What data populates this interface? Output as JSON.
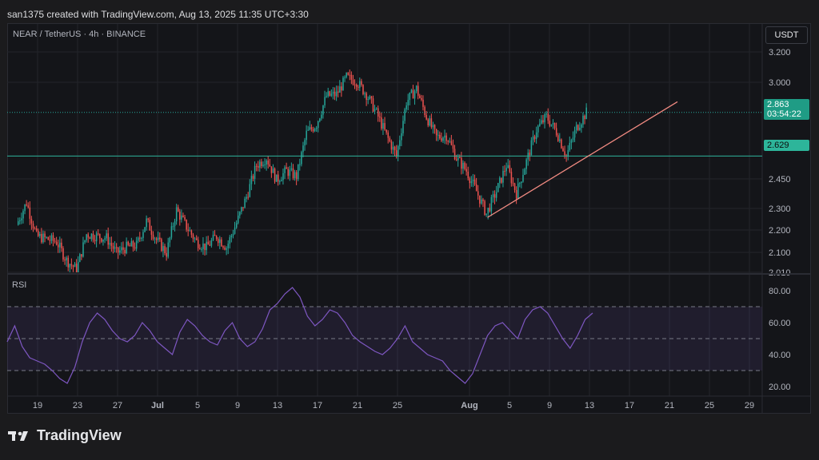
{
  "header": {
    "text": "san1375 created with TradingView.com, Aug 13, 2025 11:35 UTC+3:30"
  },
  "symbol": {
    "text": "NEAR / TetherUS · 4h · BINANCE"
  },
  "price_axis": {
    "currency": "USDT",
    "ticks": [
      "3.200",
      "3.000",
      "2.450",
      "2.300",
      "2.200",
      "2.100",
      "2.010"
    ]
  },
  "current_price": {
    "value": "2.863",
    "countdown": "03:54:22"
  },
  "level_price": {
    "value": "2.629"
  },
  "rsi": {
    "label": "RSI",
    "ticks": [
      "80.00",
      "60.00",
      "40.00",
      "20.00"
    ]
  },
  "time_axis": {
    "ticks": [
      "19",
      "23",
      "27",
      "Jul",
      "5",
      "9",
      "13",
      "17",
      "21",
      "25",
      "Aug",
      "5",
      "9",
      "13",
      "17",
      "21",
      "25",
      "29"
    ]
  },
  "brand": {
    "name": "TradingView"
  },
  "colors": {
    "up": "#26a69a",
    "down": "#ef5350",
    "rsi_line": "#7e57c2",
    "trendline": "#f28b82",
    "level": "#2db59a"
  },
  "chart_data": {
    "type": "candlestick",
    "title": "NEAR / TetherUS · 4h · BINANCE",
    "ylim": [
      2.01,
      3.26
    ],
    "x_labels": [
      "19",
      "23",
      "27",
      "Jul",
      "5",
      "9",
      "13",
      "17",
      "21",
      "25",
      "Aug",
      "5",
      "9",
      "13",
      "17",
      "21",
      "25",
      "29"
    ],
    "price_path": [
      [
        "Jun 17",
        2.26
      ],
      [
        "Jun 18",
        2.38
      ],
      [
        "Jun 19",
        2.2
      ],
      [
        "Jun 21",
        2.17
      ],
      [
        "Jun 22",
        2.07
      ],
      [
        "Jun 23",
        2.02
      ],
      [
        "Jun 24",
        2.21
      ],
      [
        "Jun 26",
        2.19
      ],
      [
        "Jun 27",
        2.11
      ],
      [
        "Jun 28",
        2.14
      ],
      [
        "Jun 29",
        2.15
      ],
      [
        "Jun 30",
        2.28
      ],
      [
        "Jul 1",
        2.18
      ],
      [
        "Jul 2",
        2.11
      ],
      [
        "Jul 3",
        2.34
      ],
      [
        "Jul 4",
        2.25
      ],
      [
        "Jul 5",
        2.17
      ],
      [
        "Jul 6",
        2.14
      ],
      [
        "Jul 7",
        2.2
      ],
      [
        "Jul 8",
        2.14
      ],
      [
        "Jul 9",
        2.27
      ],
      [
        "Jul 10",
        2.41
      ],
      [
        "Jul 11",
        2.58
      ],
      [
        "Jul 12",
        2.62
      ],
      [
        "Jul 13",
        2.5
      ],
      [
        "Jul 14",
        2.55
      ],
      [
        "Jul 15",
        2.52
      ],
      [
        "Jul 16",
        2.75
      ],
      [
        "Jul 17",
        2.8
      ],
      [
        "Jul 18",
        2.95
      ],
      [
        "Jul 19",
        2.96
      ],
      [
        "Jul 20",
        3.05
      ],
      [
        "Jul 21",
        3.03
      ],
      [
        "Jul 22",
        2.96
      ],
      [
        "Jul 23",
        2.86
      ],
      [
        "Jul 24",
        2.74
      ],
      [
        "Jul 25",
        2.63
      ],
      [
        "Jul 26",
        2.92
      ],
      [
        "Jul 27",
        2.99
      ],
      [
        "Jul 28",
        2.84
      ],
      [
        "Jul 29",
        2.73
      ],
      [
        "Jul 30",
        2.74
      ],
      [
        "Jul 31",
        2.62
      ],
      [
        "Aug 1",
        2.55
      ],
      [
        "Aug 2",
        2.44
      ],
      [
        "Aug 3",
        2.32
      ],
      [
        "Aug 4",
        2.44
      ],
      [
        "Aug 5",
        2.58
      ],
      [
        "Aug 6",
        2.43
      ],
      [
        "Aug 7",
        2.6
      ],
      [
        "Aug 8",
        2.77
      ],
      [
        "Aug 9",
        2.84
      ],
      [
        "Aug 10",
        2.76
      ],
      [
        "Aug 11",
        2.63
      ],
      [
        "Aug 12",
        2.78
      ],
      [
        "Aug 13",
        2.863
      ]
    ],
    "horizontal_level": 2.629,
    "current_price_line": 2.863,
    "trendline": {
      "from": [
        "Aug 3",
        2.3
      ],
      "to": [
        "Aug 22",
        2.92
      ]
    },
    "rsi_panel": {
      "ylim": [
        15,
        88
      ],
      "bands": [
        30,
        50,
        70
      ],
      "values": [
        48,
        58,
        45,
        38,
        36,
        34,
        30,
        25,
        22,
        32,
        48,
        60,
        66,
        62,
        55,
        50,
        48,
        52,
        60,
        55,
        48,
        44,
        40,
        54,
        62,
        58,
        52,
        48,
        46,
        55,
        60,
        50,
        45,
        48,
        56,
        68,
        72,
        78,
        82,
        76,
        64,
        58,
        62,
        68,
        66,
        60,
        52,
        48,
        45,
        42,
        40,
        44,
        50,
        58,
        48,
        44,
        40,
        38,
        36,
        30,
        26,
        22,
        28,
        40,
        52,
        58,
        60,
        55,
        50,
        62,
        68,
        70,
        66,
        58,
        50,
        44,
        52,
        62,
        66
      ]
    }
  }
}
